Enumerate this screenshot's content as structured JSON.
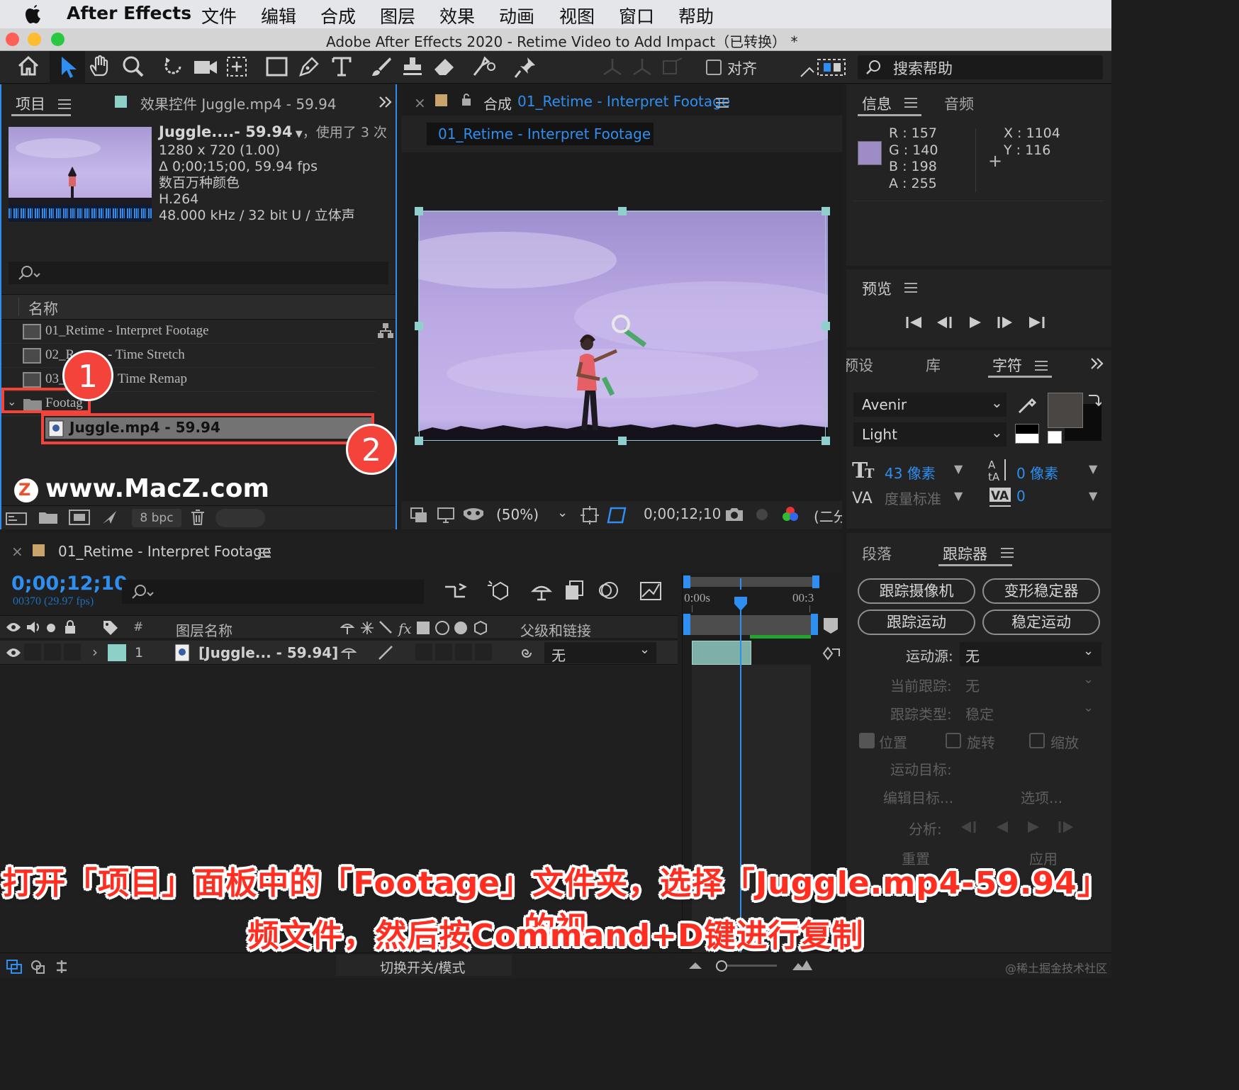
{
  "menubar": {
    "app": "After Effects",
    "items": [
      "文件",
      "编辑",
      "合成",
      "图层",
      "效果",
      "动画",
      "视图",
      "窗口",
      "帮助"
    ]
  },
  "titlebar": {
    "title": "Adobe After Effects 2020 - Retime Video to Add Impact（已转换） *"
  },
  "toolbar": {
    "snap_label": "对齐",
    "help_placeholder": "搜索帮助"
  },
  "project": {
    "tab": "项目",
    "effects_tab": "效果控件 Juggle.mp4 - 59.94",
    "info": {
      "name": "Juggle....- 59.94",
      "used": "，使用了 3 次",
      "res": "1280 x 720 (1.00)",
      "duration": "Δ 0;00;15;00, 59.94 fps",
      "colors": "数百万种颜色",
      "codec": "H.264",
      "audio": "48.000 kHz / 32 bit U / 立体声"
    },
    "col_name": "名称",
    "items": [
      "01_Retime - Interpret Footage",
      "02_R",
      "- Time Stretch",
      "03_",
      "Time Remap",
      "Footag",
      "Juggle.mp4 - 59.94"
    ],
    "bpc": "8 bpc",
    "watermark": "www.MacZ.com"
  },
  "comp": {
    "tab_prefix": "合成",
    "tab_name": "01_Retime - Interpret Footage",
    "flow_label": "01_Retime - Interpret Footage",
    "zoom": "(50%)",
    "timecode": "0;00;12;10",
    "res_frag": "(二分"
  },
  "info_panel": {
    "tab": "信息",
    "audio_tab": "音频",
    "r": "R :  157",
    "g": "G :  140",
    "b": "B :  198",
    "a": "A :  255",
    "x": "X : 1104",
    "y": "Y :  116",
    "swatch": "#9d8cc6"
  },
  "preview": {
    "title": "预览"
  },
  "character": {
    "tabs": [
      "预设",
      "库",
      "字符"
    ],
    "font": "Avenir",
    "style": "Light",
    "size": "43 像素",
    "leading": "0 像素",
    "kerning": "度量标准",
    "tracking": "0"
  },
  "timeline": {
    "tab": "01_Retime - Interpret Footage",
    "timecode": "0;00;12;10",
    "frames": "00370 (29.97 fps)",
    "col_layer": "图层名称",
    "col_parent": "父级和链接",
    "hash": "#",
    "layer": {
      "num": "1",
      "name": "[Juggle... - 59.94]",
      "parent": "无"
    },
    "ruler_start": "0:00s",
    "ruler_end": "00:3",
    "toggle": "切换开关/模式"
  },
  "tracker": {
    "tabs": [
      "段落",
      "跟踪器"
    ],
    "btn_cam": "跟踪摄像机",
    "btn_warp": "变形稳定器",
    "btn_track": "跟踪运动",
    "btn_stab": "稳定运动",
    "source_label": "运动源:",
    "source_value": "无",
    "current_label": "当前跟踪:",
    "current_value": "无",
    "type_label": "跟踪类型:",
    "type_value": "稳定",
    "pos": "位置",
    "rot": "旋转",
    "scale": "缩放",
    "target": "运动目标:",
    "edit_target": "编辑目标...",
    "options": "选项...",
    "analyze": "分析:",
    "reset": "重置",
    "apply": "应用"
  },
  "annotations": {
    "badge1": "1",
    "badge2": "2",
    "caption_line1": "打开「项目」面板中的「Footage」文件夹，选择「Juggle.mp4-59.94」的视",
    "caption_line2": "频文件，然后按Command+D键进行复制",
    "credit": "@稀土掘金技术社区"
  }
}
